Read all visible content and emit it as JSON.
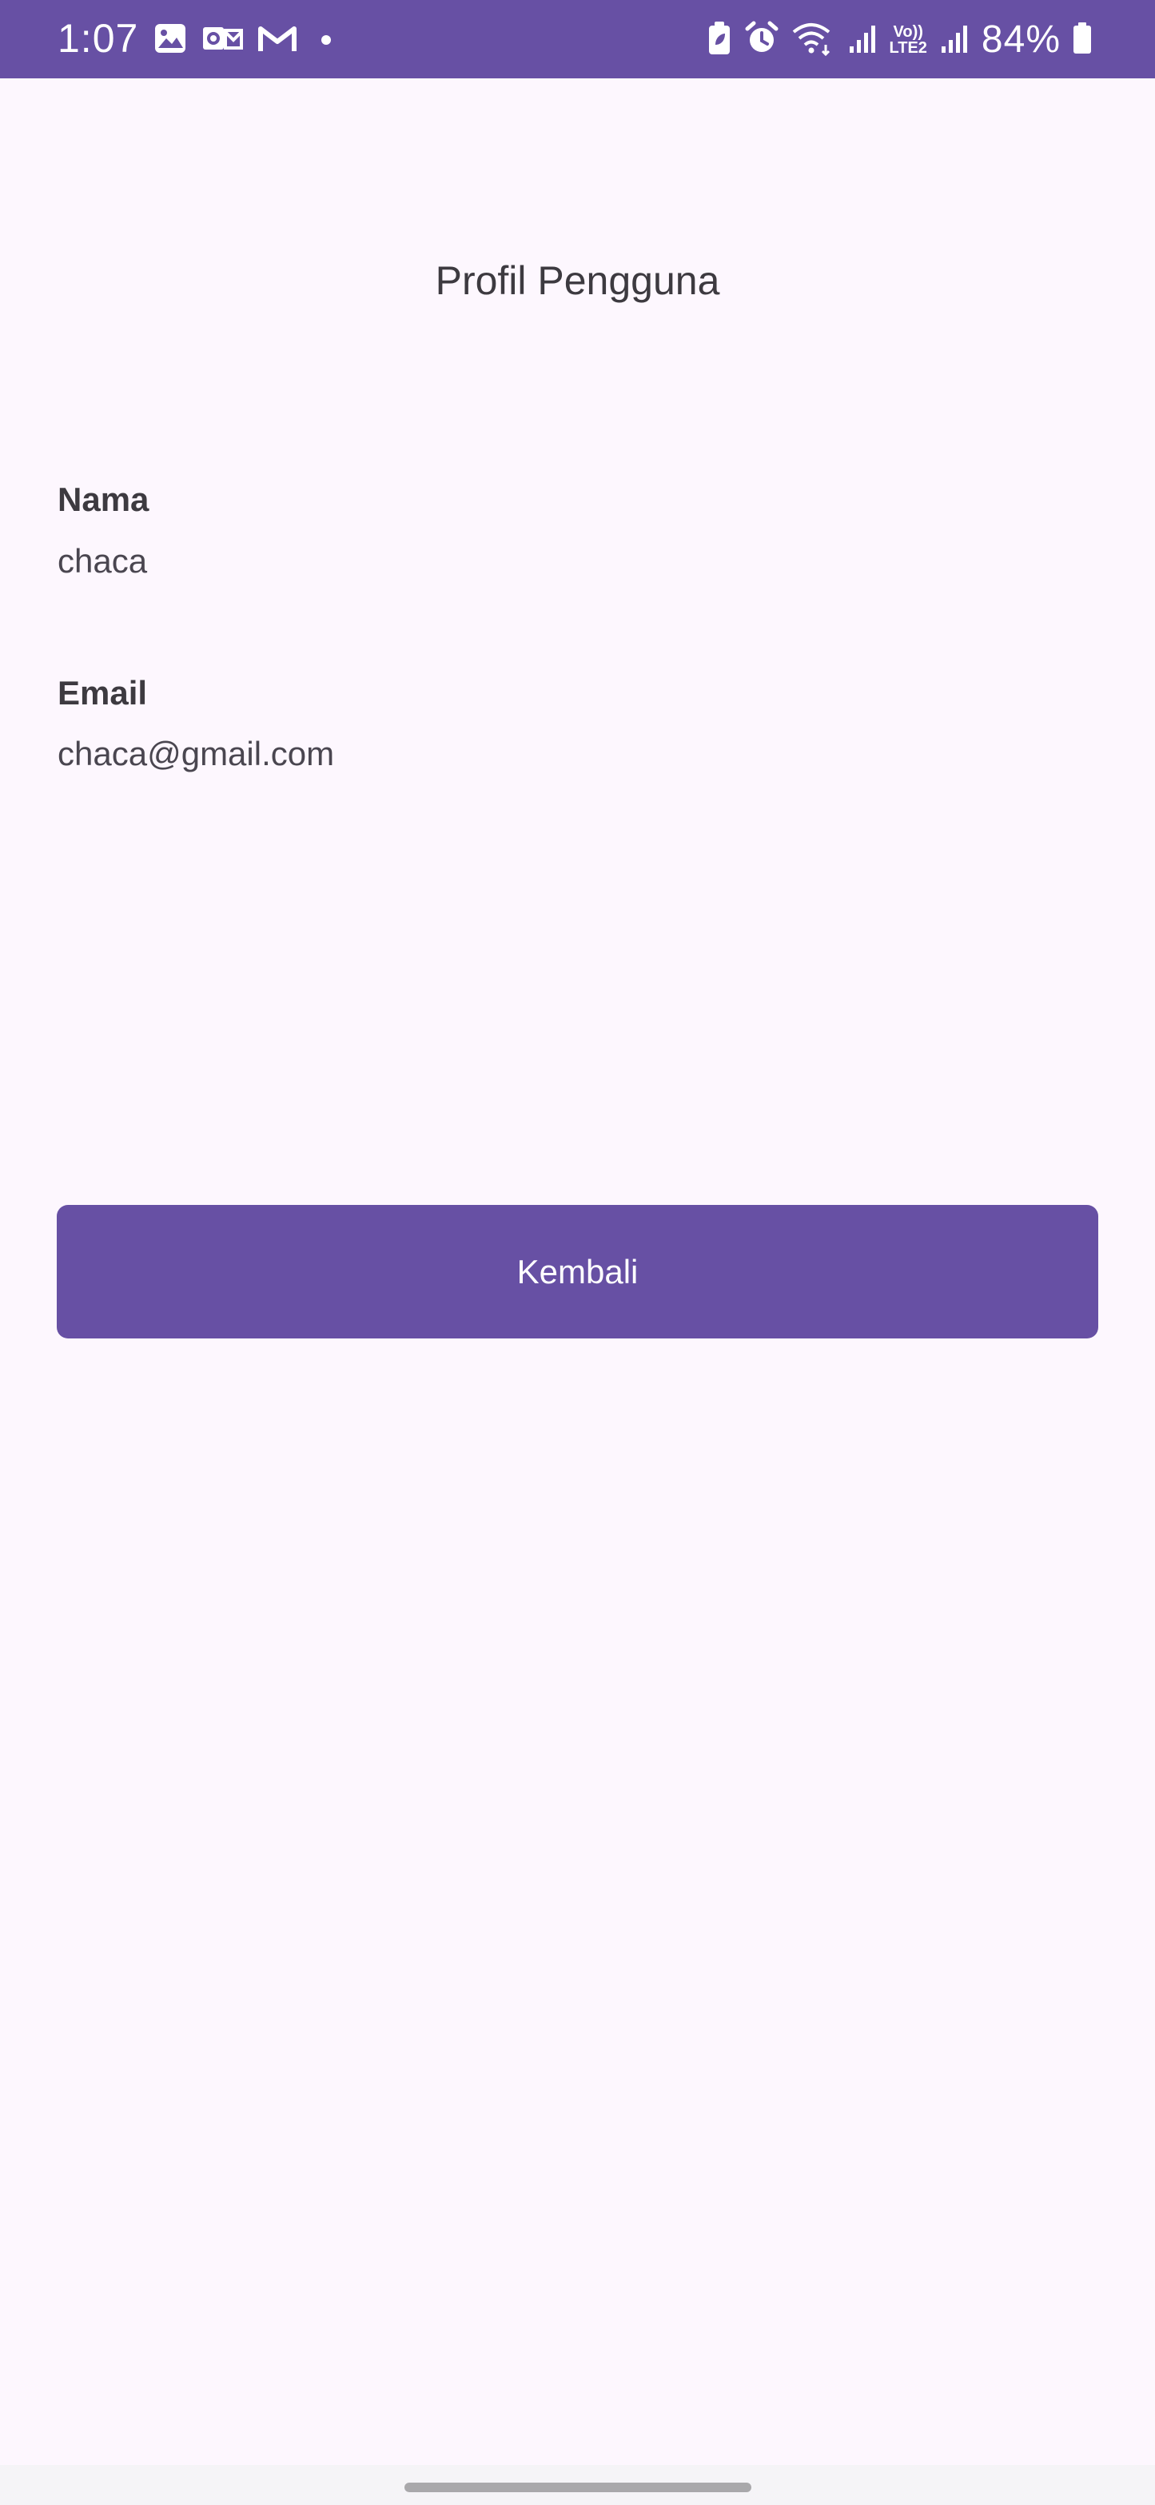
{
  "status_bar": {
    "time": "1:07",
    "battery": "84%",
    "volte_top": "Vo))",
    "volte_bottom": "LTE2",
    "left_icons": [
      "gallery-icon",
      "outlook-icon",
      "gmail-icon",
      "notification-dot"
    ],
    "right_icons": [
      "battery-saver-icon",
      "alarm-icon",
      "wifi-icon",
      "signal-icon",
      "volte-icon",
      "signal-icon",
      "battery-icon"
    ],
    "background": "#6750a4"
  },
  "page": {
    "title": "Profil Pengguna"
  },
  "fields": {
    "name_label": "Nama",
    "name_value": "chaca",
    "email_label": "Email",
    "email_value": "chaca@gmail.com"
  },
  "actions": {
    "back_label": "Kembali",
    "accent": "#6750a4"
  }
}
